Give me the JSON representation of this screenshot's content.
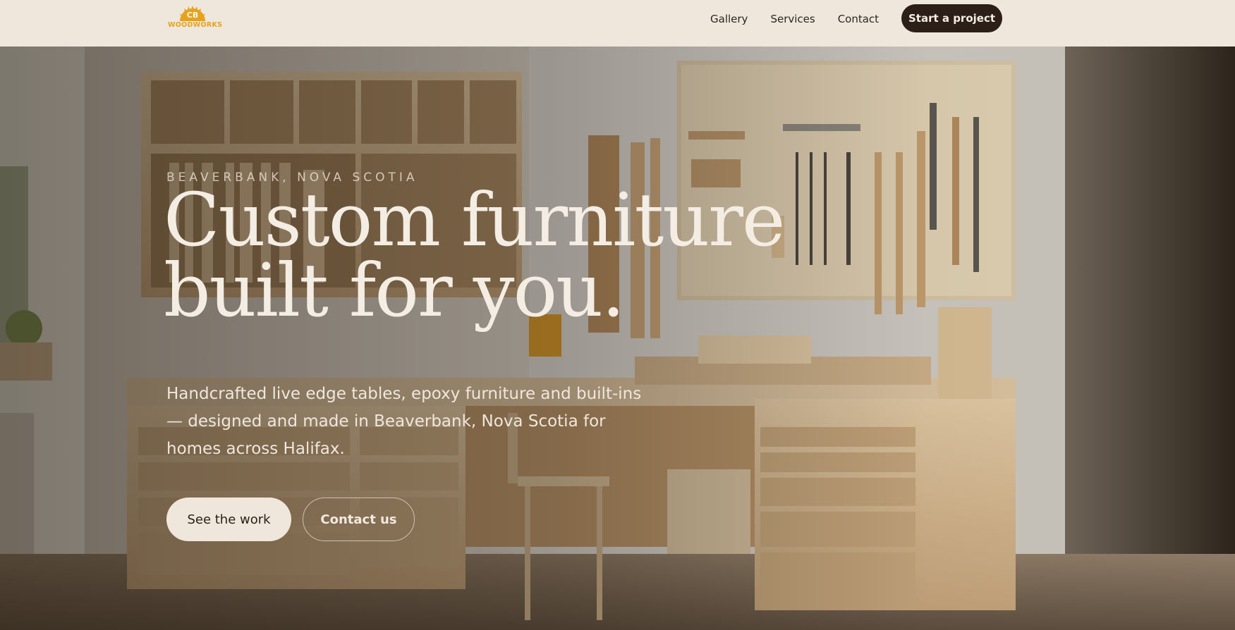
{
  "brand": {
    "monogram": "CB",
    "wordmark": "WOODWORKS",
    "accent": "#e6a21d"
  },
  "nav": {
    "links": [
      "Gallery",
      "Services",
      "Contact"
    ],
    "cta": "Start a project"
  },
  "hero": {
    "eyebrow": "BEAVERBANK, NOVA SCOTIA",
    "headline_line1": "Custom furniture",
    "headline_line2": "built for you.",
    "subtext": "Handcrafted live edge tables, epoxy furniture and built-ins — designed and made in Beaverbank, Nova Scotia for homes across Halifax.",
    "primary_cta": "See the work",
    "secondary_cta": "Contact us"
  },
  "colors": {
    "nav_bg": "#efe7dc",
    "cta_bg": "#2b1f17",
    "text_light": "#f4ede4"
  }
}
